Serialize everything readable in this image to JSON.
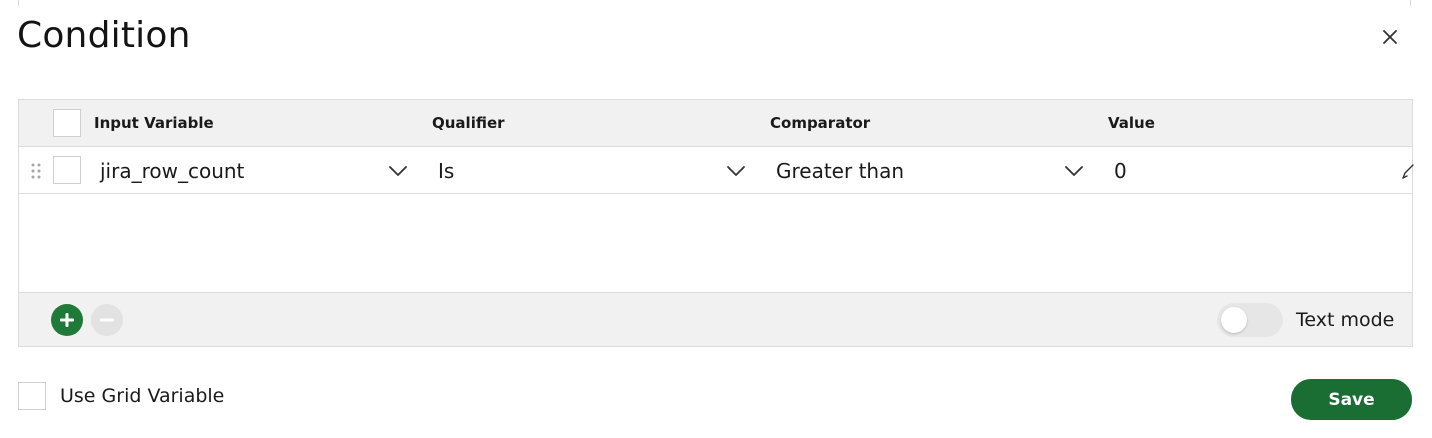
{
  "dialog": {
    "title": "Condition"
  },
  "columns": [
    "Input Variable",
    "Qualifier",
    "Comparator",
    "Value"
  ],
  "rows": [
    {
      "input_variable": "jira_row_count",
      "qualifier": "Is",
      "comparator": "Greater than",
      "value": "0"
    }
  ],
  "footer": {
    "text_mode_label": "Text mode",
    "text_mode_on": false
  },
  "use_grid_variable": {
    "label": "Use Grid Variable",
    "checked": false
  },
  "save_label": "Save",
  "colors": {
    "primary": "#1a6d33",
    "add_button": "#1f7a3a",
    "header_bg": "#f1f1f1",
    "border": "#dcdcdc"
  },
  "icons": {
    "close": "close-icon",
    "drag": "drag-handle-icon",
    "dropdown": "chevron-down-icon",
    "edit": "pencil-icon",
    "add": "plus-icon",
    "remove": "minus-icon"
  }
}
